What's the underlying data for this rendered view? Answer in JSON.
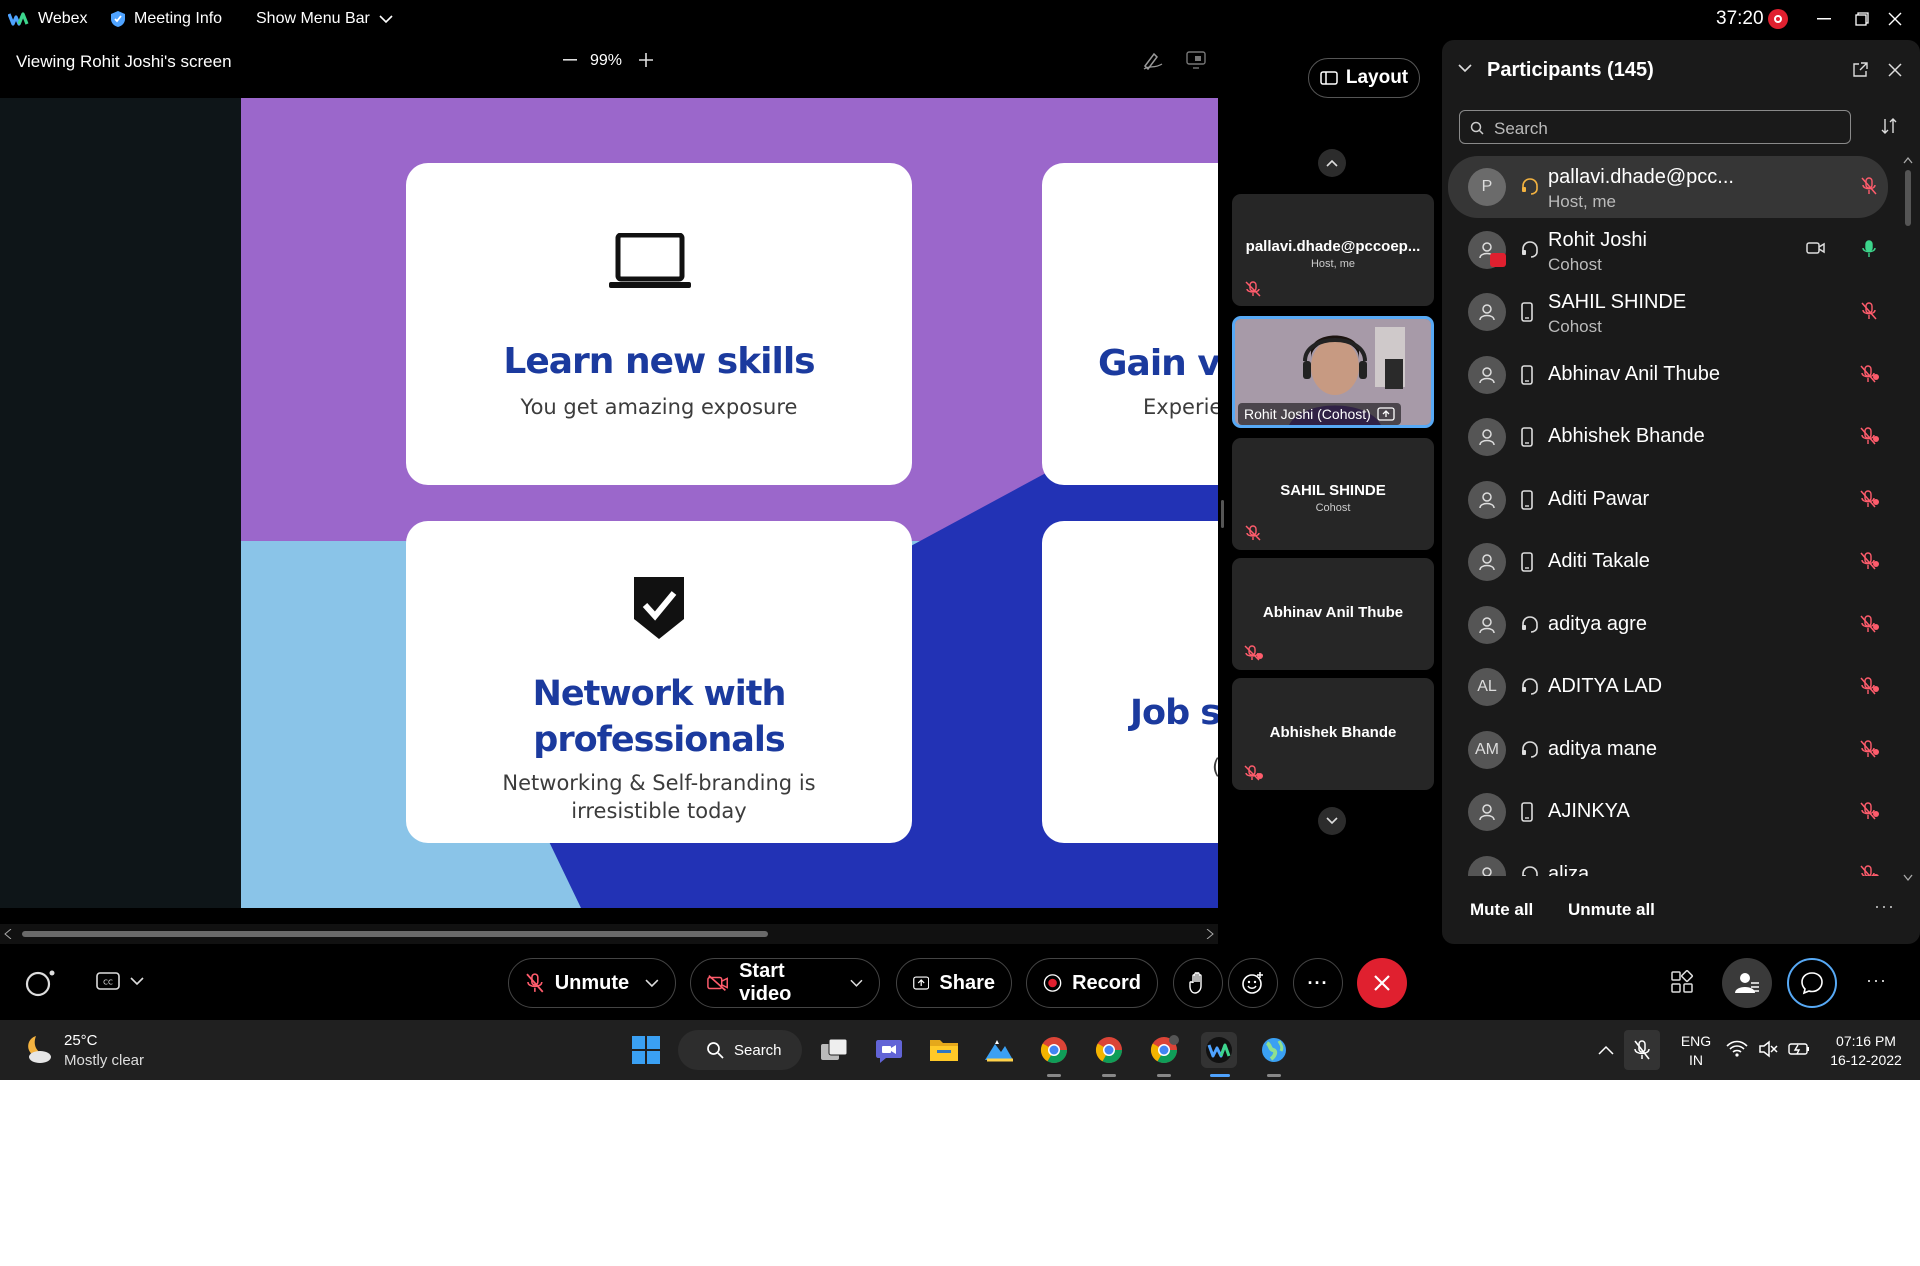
{
  "titlebar": {
    "app_name": "Webex",
    "meeting_info": "Meeting Info",
    "show_menu_bar": "Show Menu Bar",
    "timer": "37:20"
  },
  "viewbar": {
    "viewing_label": "Viewing Rohit Joshi's screen",
    "zoom": "99%"
  },
  "slide": {
    "cards": [
      {
        "title": "Learn new skills",
        "subtitle": "You get amazing exposure",
        "icon": "laptop-icon"
      },
      {
        "title": "Gain val",
        "subtitle": "Experie"
      },
      {
        "title_line1": "Network with",
        "title_line2": "professionals",
        "subtitle_line1": "Networking & Self-branding is",
        "subtitle_line2": "irresistible today",
        "icon": "shield-check-icon"
      },
      {
        "title": "Job su",
        "subtitle": "("
      }
    ],
    "colors": {
      "purple": "#9b67cb",
      "navy": "#2232b5",
      "sky": "#8ac4e8",
      "title_blue": "#1b3a9e"
    }
  },
  "layout_button": "Layout",
  "tiles": [
    {
      "name": "pallavi.dhade@pccoep...",
      "role": "Host, me"
    },
    {
      "name": "Rohit Joshi (Cohost)",
      "active": true
    },
    {
      "name": "SAHIL SHINDE",
      "role": "Cohost"
    },
    {
      "name": "Abhinav Anil Thube",
      "role": ""
    },
    {
      "name": "Abhishek Bhande",
      "role": ""
    }
  ],
  "participants": {
    "title": "Participants (145)",
    "search_placeholder": "Search",
    "list": [
      {
        "initials": "P",
        "name": "pallavi.dhade@pcc...",
        "role": "Host, me",
        "device": "headset",
        "mic": "muted"
      },
      {
        "initials": "",
        "name": "Rohit Joshi",
        "role": "Cohost",
        "device": "headset",
        "mic": "on",
        "camera": true,
        "sharing": true
      },
      {
        "initials": "",
        "name": "SAHIL SHINDE",
        "role": "Cohost",
        "device": "phone",
        "mic": "muted"
      },
      {
        "initials": "",
        "name": "Abhinav Anil Thube",
        "role": "",
        "device": "phone",
        "mic": "muted-by-host"
      },
      {
        "initials": "",
        "name": "Abhishek Bhande",
        "role": "",
        "device": "phone",
        "mic": "muted-by-host"
      },
      {
        "initials": "",
        "name": "Aditi Pawar",
        "role": "",
        "device": "phone",
        "mic": "muted-by-host"
      },
      {
        "initials": "",
        "name": "Aditi Takale",
        "role": "",
        "device": "phone",
        "mic": "muted-by-host"
      },
      {
        "initials": "",
        "name": "aditya agre",
        "role": "",
        "device": "headset",
        "mic": "muted-by-host"
      },
      {
        "initials": "AL",
        "name": "ADITYA LAD",
        "role": "",
        "device": "headset",
        "mic": "muted-by-host"
      },
      {
        "initials": "AM",
        "name": "aditya mane",
        "role": "",
        "device": "headset",
        "mic": "muted-by-host"
      },
      {
        "initials": "",
        "name": "AJINKYA",
        "role": "",
        "device": "phone",
        "mic": "muted-by-host"
      },
      {
        "initials": "",
        "name": "aliza",
        "role": "",
        "device": "headset",
        "mic": "muted-by-host"
      }
    ],
    "mute_all": "Mute all",
    "unmute_all": "Unmute all"
  },
  "controls": {
    "unmute": "Unmute",
    "start_video": "Start video",
    "share": "Share",
    "record": "Record",
    "end_color": "#e0202f"
  },
  "taskbar": {
    "temperature": "25°C",
    "weather": "Mostly clear",
    "search": "Search",
    "lang_line1": "ENG",
    "lang_line2": "IN",
    "time": "07:16 PM",
    "date": "16-12-2022"
  }
}
